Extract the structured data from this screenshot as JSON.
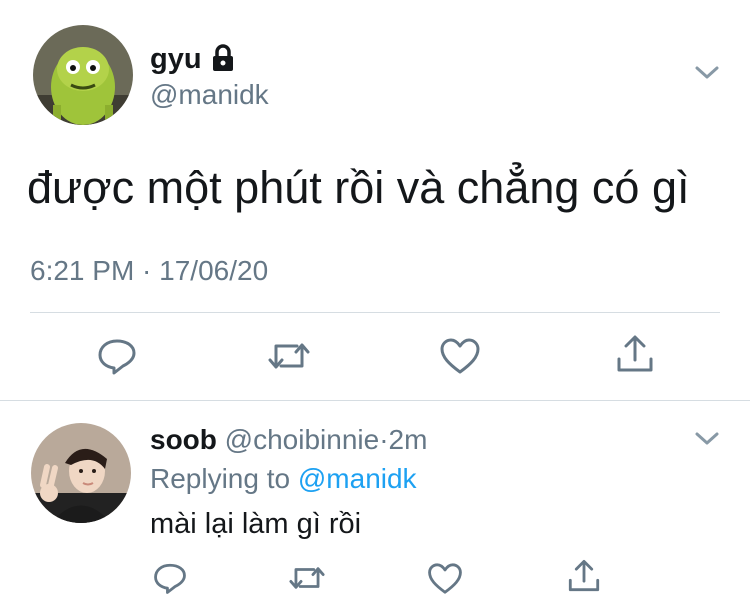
{
  "tweet": {
    "display_name": "gyu",
    "handle": "@manidk",
    "text": "được một phút rồi và chẳng có gì",
    "timestamp": "6:21 PM · 17/06/20"
  },
  "reply": {
    "display_name": "soob",
    "handle": "@choibinnie",
    "separator": "·",
    "time": "2m",
    "replying_prefix": "Replying to",
    "replying_handle": "@manidk",
    "text": "mài lại làm gì rồi"
  },
  "icons": {
    "lock": "lock-icon",
    "menu": "chevron-down-icon",
    "reply": "reply-icon",
    "retweet": "retweet-icon",
    "like": "heart-icon",
    "share": "share-icon"
  },
  "colors": {
    "text": "#14171a",
    "muted": "#657786",
    "link": "#1da1f2",
    "divider": "#d6dde2"
  }
}
